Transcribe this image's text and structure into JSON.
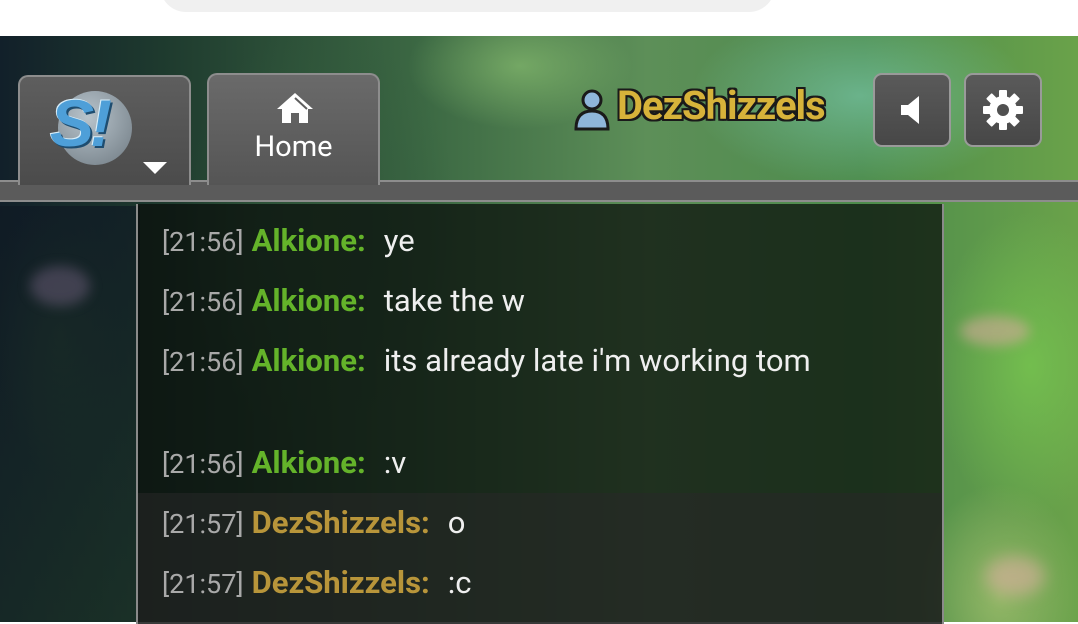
{
  "header": {
    "home_tab_label": "Home",
    "username": "DezShizzels",
    "logo_text": "S!"
  },
  "colors": {
    "username_gold": "#d7b33a",
    "nick_green": "#64b32a",
    "nick_gold": "#b8953a"
  },
  "icons": {
    "home": "home-icon",
    "user": "user-icon",
    "sound": "speaker-icon",
    "settings": "gear-icon",
    "caret": "caret-down-icon"
  },
  "chat": {
    "messages": [
      {
        "time": "[21:56]",
        "nick": "Alkione:",
        "text": "ye"
      },
      {
        "time": "[21:56]",
        "nick": "Alkione:",
        "text": "take the w"
      },
      {
        "time": "[21:56]",
        "nick": "Alkione:",
        "text": "its already late i'm working tom"
      },
      {
        "time": "[21:56]",
        "nick": "Alkione:",
        "text": ":v"
      },
      {
        "time": "[21:57]",
        "nick": "DezShizzels:",
        "text": "o"
      },
      {
        "time": "[21:57]",
        "nick": "DezShizzels:",
        "text": ":c"
      }
    ]
  }
}
